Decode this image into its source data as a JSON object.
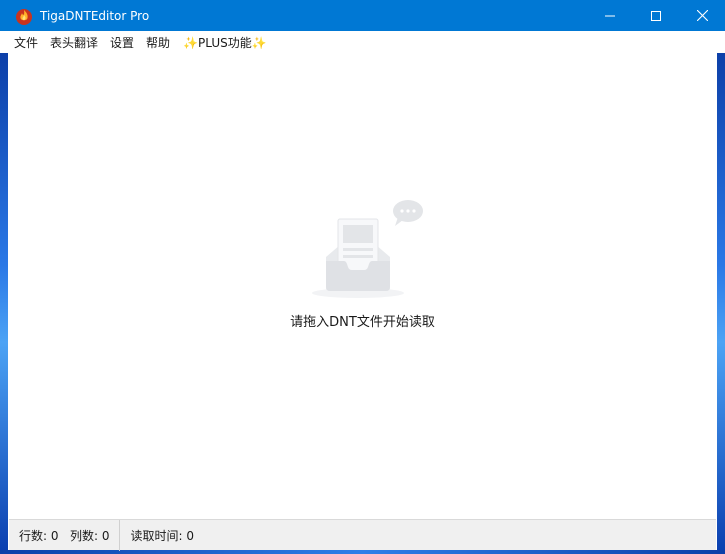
{
  "window": {
    "title": "TigaDNTEditor Pro",
    "app_icon": "flame-logo-icon",
    "controls": {
      "minimize": "minimize-icon",
      "maximize": "maximize-icon",
      "close": "close-icon"
    }
  },
  "menu": {
    "items": [
      {
        "label": "文件"
      },
      {
        "label": "表头翻译"
      },
      {
        "label": "设置"
      },
      {
        "label": "帮助"
      },
      {
        "label": "✨PLUS功能✨"
      }
    ]
  },
  "empty_state": {
    "icon": "empty-inbox-icon",
    "message": "请拖入DNT文件开始读取"
  },
  "status": {
    "rows_label": "行数:",
    "rows_value": "0",
    "cols_label": "列数:",
    "cols_value": "0",
    "read_time_label": "读取时间:",
    "read_time_value": "0"
  },
  "colors": {
    "titlebar": "#0078d4",
    "statusbar": "#f0f0f0"
  }
}
